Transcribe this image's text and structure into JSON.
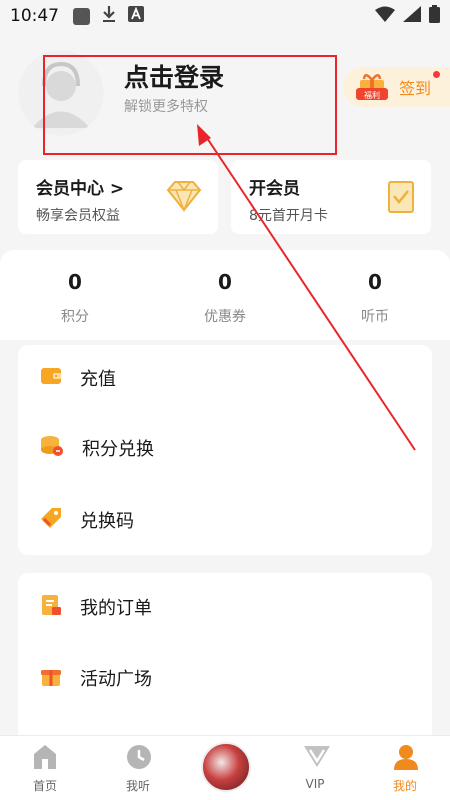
{
  "status_bar": {
    "time": "10:47"
  },
  "profile": {
    "login_title": "点击登录",
    "login_subtitle": "解锁更多特权",
    "checkin_badge": "福利",
    "checkin_label": "签到"
  },
  "member_cards": [
    {
      "title": "会员中心 >",
      "subtitle": "畅享会员权益",
      "icon": "diamond-icon"
    },
    {
      "title": "开会员",
      "subtitle": "8元首开月卡",
      "icon": "vip-card-icon"
    }
  ],
  "stats": [
    {
      "value": "0",
      "label": "积分"
    },
    {
      "value": "0",
      "label": "优惠券"
    },
    {
      "value": "0",
      "label": "听币"
    }
  ],
  "menu_group_1": [
    {
      "label": "充值",
      "icon": "wallet-icon"
    },
    {
      "label": "积分兑换",
      "icon": "coins-icon"
    },
    {
      "label": "兑换码",
      "icon": "tag-icon"
    }
  ],
  "menu_group_2": [
    {
      "label": "我的订单",
      "icon": "order-icon"
    },
    {
      "label": "活动广场",
      "icon": "gift-box-icon"
    }
  ],
  "tabbar": [
    {
      "label": "首页",
      "icon": "home-icon",
      "active": false
    },
    {
      "label": "我听",
      "icon": "clock-icon",
      "active": false
    },
    {
      "label": "",
      "icon": "now-playing-disc",
      "active": false
    },
    {
      "label": "VIP",
      "icon": "vip-icon",
      "active": false
    },
    {
      "label": "我的",
      "icon": "person-icon",
      "active": true
    }
  ],
  "colors": {
    "accent": "#f08a1c",
    "annotation_red": "#e8252b",
    "background": "#f5f5f5"
  }
}
